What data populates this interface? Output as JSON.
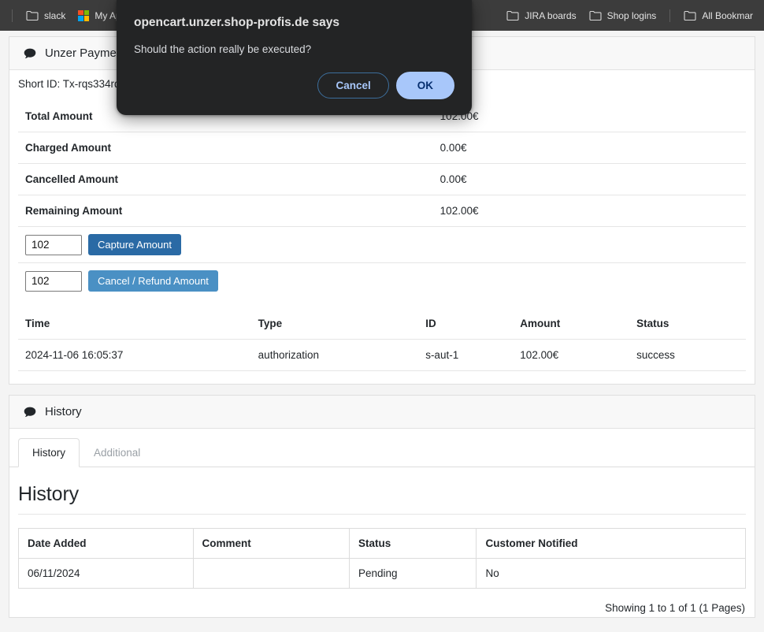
{
  "browser": {
    "bookmarks": [
      {
        "label": "slack",
        "icon": "folder-icon"
      },
      {
        "label": "My Ap",
        "icon": "microsoft-icon"
      },
      {
        "label": "JIRA boards",
        "icon": "folder-icon"
      },
      {
        "label": "Shop logins",
        "icon": "folder-icon"
      },
      {
        "label": "All Bookmar",
        "icon": "folder-icon"
      }
    ]
  },
  "dialog": {
    "title": "opencart.unzer.shop-profis.de says",
    "message": "Should the action really be executed?",
    "cancel_label": "Cancel",
    "ok_label": "OK",
    "ok_bg": "#a8c7fa",
    "ok_fg": "#062e6f",
    "cancel_border": "#3c6e9c",
    "background": "#232425"
  },
  "payment_panel": {
    "heading": "Unzer Payment",
    "heading_icon": "comment-bubble-icon",
    "short_id": "Short ID: Tx-rqs334rd",
    "amounts": [
      {
        "label": "Total Amount",
        "value": "102.00€"
      },
      {
        "label": "Charged Amount",
        "value": "0.00€"
      },
      {
        "label": "Cancelled Amount",
        "value": "0.00€"
      },
      {
        "label": "Remaining Amount",
        "value": "102.00€"
      }
    ],
    "capture": {
      "input_value": "102",
      "input_placeholder": "",
      "button_label": "Capture Amount",
      "button_color": "#2a6aa5"
    },
    "refund": {
      "input_value": "102",
      "input_placeholder": "",
      "button_label": "Cancel / Refund Amount",
      "button_color": "#4a90c4"
    },
    "transactions": {
      "columns": [
        "Time",
        "Type",
        "ID",
        "Amount",
        "Status"
      ],
      "rows": [
        {
          "time": "2024-11-06 16:05:37",
          "type": "authorization",
          "id": "s-aut-1",
          "amount": "102.00€",
          "status": "success"
        }
      ]
    }
  },
  "history_panel": {
    "heading": "History",
    "heading_icon": "comment-bubble-icon",
    "tabs": [
      {
        "label": "History",
        "active": true
      },
      {
        "label": "Additional",
        "active": false
      }
    ],
    "title": "History",
    "table": {
      "columns": [
        "Date Added",
        "Comment",
        "Status",
        "Customer Notified"
      ],
      "rows": [
        {
          "date_added": "06/11/2024",
          "comment": "",
          "status": "Pending",
          "customer_notified": "No"
        }
      ]
    },
    "showing": "Showing 1 to 1 of 1 (1 Pages)"
  }
}
